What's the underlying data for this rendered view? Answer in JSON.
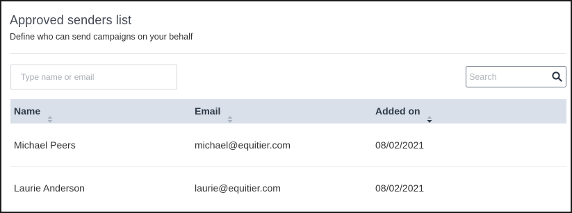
{
  "header": {
    "title": "Approved senders list",
    "subtitle": "Define who can send campaigns on your behalf"
  },
  "add_sender": {
    "placeholder": "Type name or email",
    "value": ""
  },
  "search": {
    "placeholder": "Search",
    "value": "",
    "icon": "search-icon"
  },
  "table": {
    "columns": [
      {
        "label": "Name",
        "sort": "none",
        "icon": "sort-icon"
      },
      {
        "label": "Email",
        "sort": "none",
        "icon": "sort-icon"
      },
      {
        "label": "Added on",
        "sort": "descending",
        "icon": "sort-desc-icon"
      }
    ],
    "rows": [
      {
        "name": "Michael Peers",
        "email": "michael@equitier.com",
        "added_on": "08/02/2021"
      },
      {
        "name": "Laurie Anderson",
        "email": "laurie@equitier.com",
        "added_on": "08/02/2021"
      }
    ]
  },
  "colors": {
    "header_bg": "#d9e0ea",
    "header_text": "#2f3a47",
    "border": "#d6d9de",
    "search_border": "#6b7787"
  }
}
